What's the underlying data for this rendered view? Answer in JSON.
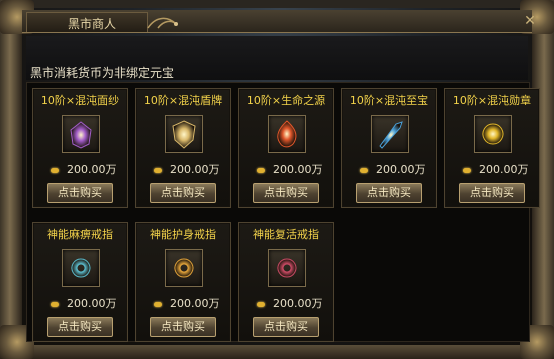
{
  "window": {
    "title": "黑市商人",
    "close_symbol": "✕"
  },
  "notice": "黑市消耗货币为非绑定元宝",
  "currency_icon": "gold-ingot-icon",
  "items": [
    {
      "name": "10阶×混沌面纱",
      "price": "200.00万",
      "buy_label": "点击购买",
      "icon": "veil-icon",
      "color": "#a25cc8"
    },
    {
      "name": "10阶×混沌盾牌",
      "price": "200.00万",
      "buy_label": "点击购买",
      "icon": "shield-icon",
      "color": "#d9b86a"
    },
    {
      "name": "10阶×生命之源",
      "price": "200.00万",
      "buy_label": "点击购买",
      "icon": "life-source-icon",
      "color": "#e0562a"
    },
    {
      "name": "10阶×混沌至宝",
      "price": "200.00万",
      "buy_label": "点击购买",
      "icon": "treasure-blade-icon",
      "color": "#4aa0d8"
    },
    {
      "name": "10阶×混沌勋章",
      "price": "200.00万",
      "buy_label": "点击购买",
      "icon": "medal-icon",
      "color": "#e2b72a"
    },
    {
      "name": "神能麻痹戒指",
      "price": "200.00万",
      "buy_label": "点击购买",
      "icon": "ring-icon",
      "color": "#5ab9c9"
    },
    {
      "name": "神能护身戒指",
      "price": "200.00万",
      "buy_label": "点击购买",
      "icon": "ring-icon",
      "color": "#e0a23a"
    },
    {
      "name": "神能复活戒指",
      "price": "200.00万",
      "buy_label": "点击购买",
      "icon": "ring-icon",
      "color": "#c84a64"
    }
  ]
}
